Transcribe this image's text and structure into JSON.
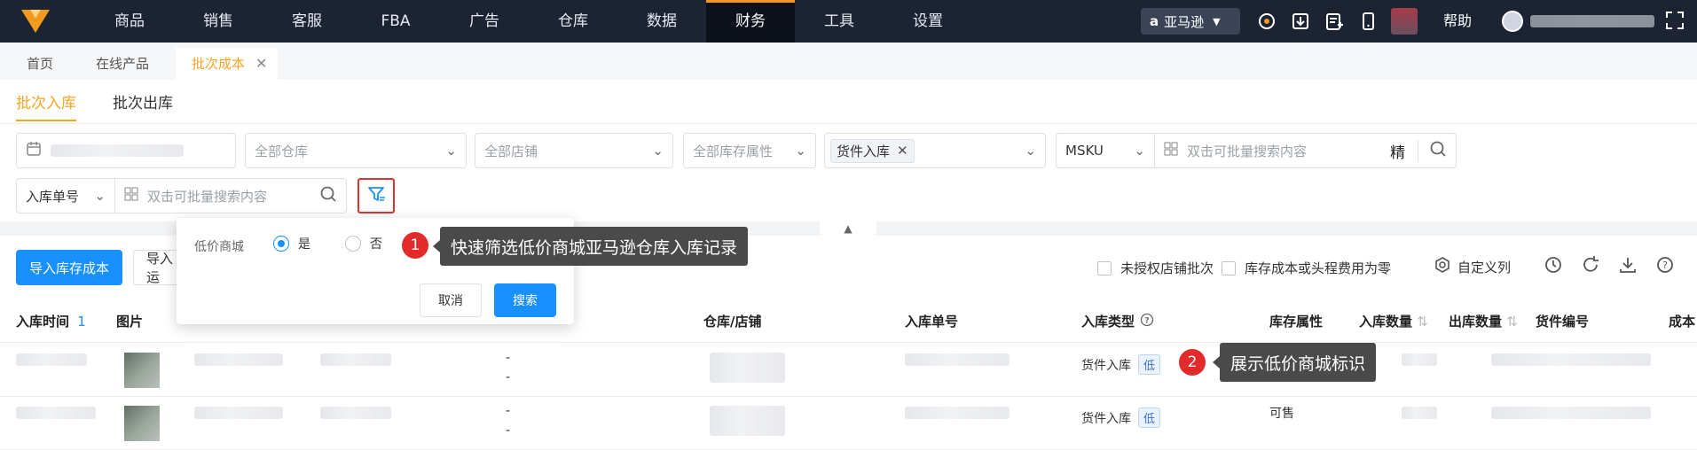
{
  "topnav": {
    "items": [
      "商品",
      "销售",
      "客服",
      "FBA",
      "广告",
      "仓库",
      "数据",
      "财务",
      "工具",
      "设置"
    ],
    "active": "财务",
    "platform": "亚马逊",
    "help": "帮助"
  },
  "tabs": [
    "首页",
    "在线产品",
    "批次成本"
  ],
  "subtabs": [
    "批次入库",
    "批次出库"
  ],
  "filters": {
    "warehouse_placeholder": "全部仓库",
    "store_placeholder": "全部店铺",
    "inventory_attr_placeholder": "全部库存属性",
    "type_tag": "货件入库",
    "sku_select": "MSKU",
    "search_placeholder": "双击可批量搜索内容",
    "exact": "精",
    "inbound_select": "入库单号",
    "search_placeholder_2": "双击可批量搜索内容"
  },
  "popover": {
    "label": "低价商城",
    "yes": "是",
    "no": "否",
    "cancel": "取消",
    "search": "搜索"
  },
  "callouts": [
    {
      "num": "1",
      "text": "快速筛选低价商城亚马逊仓库入库记录"
    },
    {
      "num": "2",
      "text": "展示低价商城标识"
    }
  ],
  "actions": {
    "import_cost": "导入库存成本",
    "import2": "导入运",
    "unauth": "未授权店铺批次",
    "zero_cost": "库存成本或头程费用为零",
    "custom_cols": "自定义列"
  },
  "table": {
    "headers": [
      "入库时间",
      "图片",
      "仓库/店铺",
      "入库单号",
      "入库类型",
      "库存属性",
      "入库数量",
      "出库数量",
      "货件编号",
      "成本"
    ],
    "sort_index": "1",
    "rows": [
      {
        "dash": "-",
        "type": "货件入库",
        "badge": "低",
        "attr": ""
      },
      {
        "dash": "-",
        "type": "货件入库",
        "badge": "低",
        "attr": "可售"
      }
    ]
  }
}
